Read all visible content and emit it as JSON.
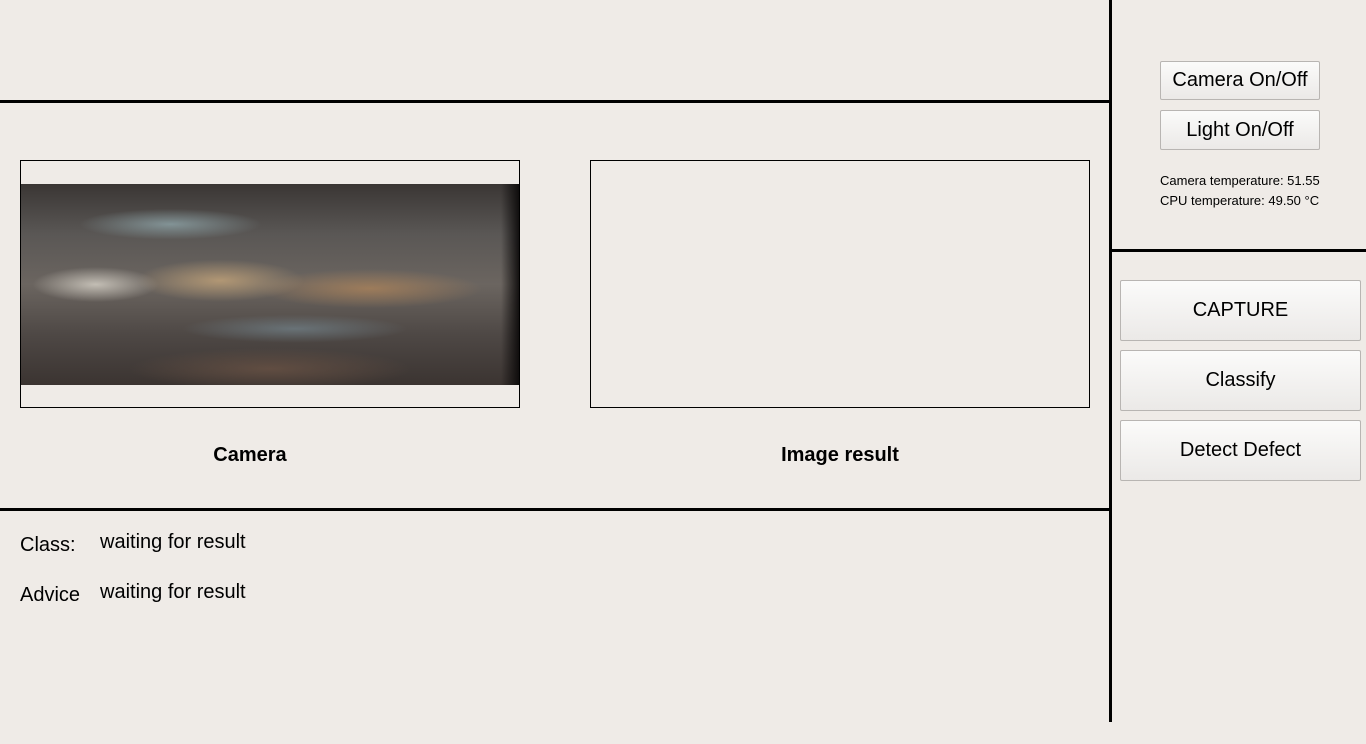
{
  "controls": {
    "camera_toggle_label": "Camera On/Off",
    "light_toggle_label": "Light On/Off",
    "camera_temperature": "Camera temperature: 51.55",
    "cpu_temperature": "CPU temperature: 49.50 °C"
  },
  "actions": {
    "capture_label": "CAPTURE",
    "classify_label": "Classify",
    "detect_label": "Detect Defect"
  },
  "views": {
    "camera_caption": "Camera",
    "result_caption": "Image result"
  },
  "results": {
    "class_label": "Class:",
    "class_value": "waiting for result",
    "advice_label": "Advice",
    "advice_value": "waiting for result"
  },
  "colors": {
    "background": "#efebe7",
    "separator": "#000000"
  }
}
